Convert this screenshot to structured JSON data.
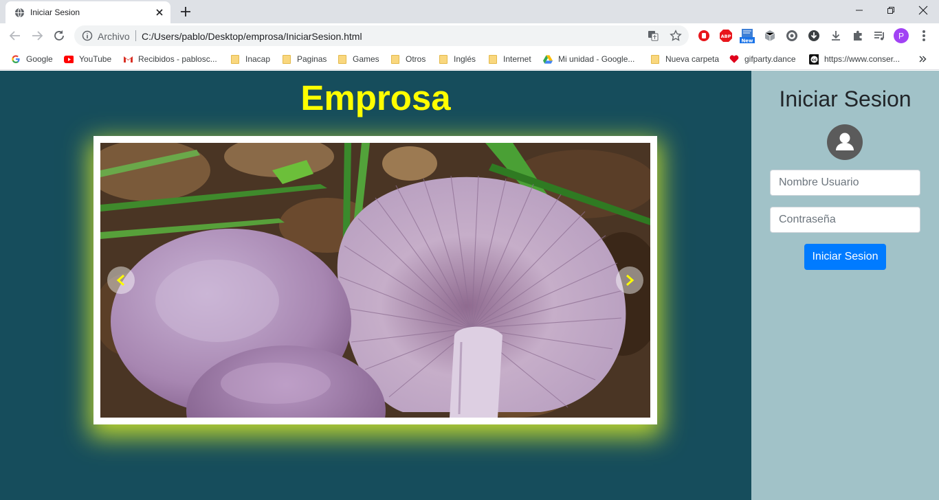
{
  "browser": {
    "tab": {
      "title": "Iniciar Sesion"
    },
    "address": {
      "scheme_label": "Archivo",
      "url": "C:/Users/pablo/Desktop/emprosa/IniciarSesion.html"
    },
    "profile_initial": "P",
    "bookmarks": [
      {
        "label": "Google",
        "icon": "google-icon"
      },
      {
        "label": "YouTube",
        "icon": "youtube-icon"
      },
      {
        "label": "Recibidos - pablosc...",
        "icon": "gmail-icon"
      },
      {
        "label": "Inacap",
        "icon": "folder-icon"
      },
      {
        "label": "Paginas",
        "icon": "folder-icon"
      },
      {
        "label": "Games",
        "icon": "folder-icon"
      },
      {
        "label": "Otros",
        "icon": "folder-icon"
      },
      {
        "label": "Inglés",
        "icon": "folder-icon"
      },
      {
        "label": "Internet",
        "icon": "folder-icon"
      },
      {
        "label": "Mi unidad - Google...",
        "icon": "drive-icon"
      },
      {
        "label": "Nueva carpeta",
        "icon": "folder-icon"
      },
      {
        "label": "gifparty.dance",
        "icon": "heart-icon"
      },
      {
        "label": "https://www.conser...",
        "icon": "cc-icon"
      }
    ]
  },
  "page": {
    "brand": "Emprosa",
    "carousel": {
      "image_subject": "purple mushrooms",
      "prev_icon": "chevron-left-icon",
      "next_icon": "chevron-right-icon"
    },
    "login": {
      "title": "Iniciar Sesion",
      "avatar_icon": "user-icon",
      "username_placeholder": "Nombre Usuario",
      "password_placeholder": "Contraseña",
      "submit_label": "Iniciar Sesion"
    }
  },
  "colors": {
    "page_bg": "#164d5c",
    "brand": "#ffff00",
    "sidebar_bg": "#a1c2c8",
    "button": "#007bff",
    "glow": "#d8ec28"
  }
}
